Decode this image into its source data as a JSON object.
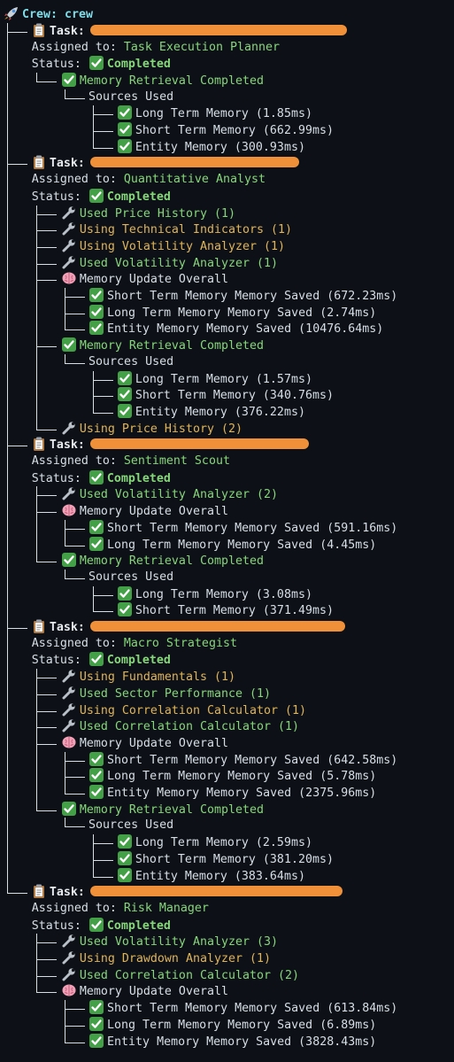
{
  "crew": {
    "icon": "rocket-icon",
    "label": "Crew: crew"
  },
  "colors": {
    "background": "#0d1117",
    "tree": "#d7dee6",
    "crew": "#7fdbe6",
    "success": "#86d67a",
    "in_progress": "#e0b458",
    "redaction": "#f0913a"
  },
  "labels": {
    "task": "Task:",
    "assigned_to": "Assigned to: ",
    "status": "Status: ",
    "completed": "Completed",
    "sources_used": "Sources Used"
  },
  "tasks": [
    {
      "assigned": "Task Execution Planner",
      "children": [
        {
          "kind": "retrieval",
          "text": "Memory Retrieval Completed",
          "sources": [
            {
              "text": "Long Term Memory (1.85ms)"
            },
            {
              "text": "Short Term Memory (662.99ms)"
            },
            {
              "text": "Entity Memory (300.93ms)"
            }
          ]
        }
      ]
    },
    {
      "assigned": "Quantitative Analyst",
      "children": [
        {
          "kind": "tool",
          "state": "done",
          "text": "Used Price History (1)"
        },
        {
          "kind": "tool",
          "state": "active",
          "text": "Using Technical Indicators (1)"
        },
        {
          "kind": "tool",
          "state": "active",
          "text": "Using Volatility Analyzer (1)"
        },
        {
          "kind": "tool",
          "state": "done",
          "text": "Used Volatility Analyzer (1)"
        },
        {
          "kind": "update",
          "text": "Memory Update Overall",
          "items": [
            {
              "text": "Short Term Memory Memory Saved (672.23ms)"
            },
            {
              "text": "Long Term Memory Memory Saved (2.74ms)"
            },
            {
              "text": "Entity Memory Memory Saved (10476.64ms)"
            }
          ]
        },
        {
          "kind": "retrieval",
          "text": "Memory Retrieval Completed",
          "sources": [
            {
              "text": "Long Term Memory (1.57ms)"
            },
            {
              "text": "Short Term Memory (340.76ms)"
            },
            {
              "text": "Entity Memory (376.22ms)"
            }
          ]
        },
        {
          "kind": "tool",
          "state": "active",
          "text": "Using Price History (2)"
        }
      ]
    },
    {
      "assigned": "Sentiment Scout",
      "children": [
        {
          "kind": "tool",
          "state": "done",
          "text": "Used Volatility Analyzer (2)"
        },
        {
          "kind": "update",
          "text": "Memory Update Overall",
          "items": [
            {
              "text": "Short Term Memory Memory Saved (591.16ms)"
            },
            {
              "text": "Long Term Memory Memory Saved (4.45ms)"
            }
          ]
        },
        {
          "kind": "retrieval",
          "text": "Memory Retrieval Completed",
          "sources": [
            {
              "text": "Long Term Memory (3.08ms)"
            },
            {
              "text": "Short Term Memory (371.49ms)"
            }
          ]
        }
      ]
    },
    {
      "assigned": "Macro Strategist",
      "children": [
        {
          "kind": "tool",
          "state": "active",
          "text": "Using Fundamentals (1)"
        },
        {
          "kind": "tool",
          "state": "done",
          "text": "Used Sector Performance (1)"
        },
        {
          "kind": "tool",
          "state": "active",
          "text": "Using Correlation Calculator (1)"
        },
        {
          "kind": "tool",
          "state": "done",
          "text": "Used Correlation Calculator (1)"
        },
        {
          "kind": "update",
          "text": "Memory Update Overall",
          "items": [
            {
              "text": "Short Term Memory Memory Saved (642.58ms)"
            },
            {
              "text": "Long Term Memory Memory Saved (5.78ms)"
            },
            {
              "text": "Entity Memory Memory Saved (2375.96ms)"
            }
          ]
        },
        {
          "kind": "retrieval",
          "text": "Memory Retrieval Completed",
          "sources": [
            {
              "text": "Long Term Memory (2.59ms)"
            },
            {
              "text": "Short Term Memory (381.20ms)"
            },
            {
              "text": "Entity Memory (383.64ms)"
            }
          ]
        }
      ]
    },
    {
      "assigned": "Risk Manager",
      "children": [
        {
          "kind": "tool",
          "state": "done",
          "text": "Used Volatility Analyzer (3)"
        },
        {
          "kind": "tool",
          "state": "active",
          "text": "Using Drawdown Analyzer (1)"
        },
        {
          "kind": "tool",
          "state": "done",
          "text": "Used Correlation Calculator (2)"
        },
        {
          "kind": "update",
          "text": "Memory Update Overall",
          "items": [
            {
              "text": "Short Term Memory Memory Saved (613.84ms)"
            },
            {
              "text": "Long Term Memory Memory Saved (6.89ms)"
            },
            {
              "text": "Entity Memory Memory Saved (3828.43ms)"
            }
          ]
        }
      ]
    }
  ]
}
